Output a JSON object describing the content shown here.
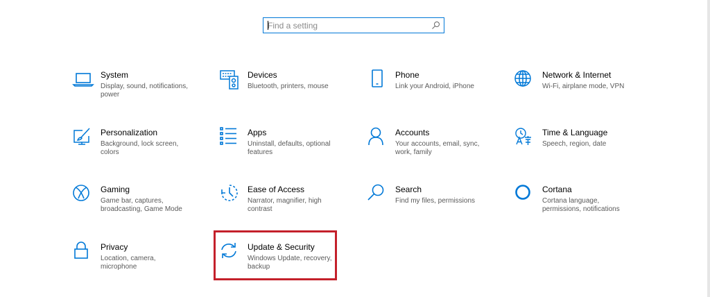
{
  "search": {
    "placeholder": "Find a setting",
    "icon": "search-icon"
  },
  "tiles": [
    {
      "title": "System",
      "desc": "Display, sound, notifications, power",
      "icon": "laptop-icon"
    },
    {
      "title": "Devices",
      "desc": "Bluetooth, printers, mouse",
      "icon": "keyboard-speaker-icon"
    },
    {
      "title": "Phone",
      "desc": "Link your Android, iPhone",
      "icon": "phone-icon"
    },
    {
      "title": "Network & Internet",
      "desc": "Wi-Fi, airplane mode, VPN",
      "icon": "globe-icon"
    },
    {
      "title": "Personalization",
      "desc": "Background, lock screen, colors",
      "icon": "paintbrush-icon"
    },
    {
      "title": "Apps",
      "desc": "Uninstall, defaults, optional features",
      "icon": "apps-list-icon"
    },
    {
      "title": "Accounts",
      "desc": "Your accounts, email, sync, work, family",
      "icon": "person-icon"
    },
    {
      "title": "Time & Language",
      "desc": "Speech, region, date",
      "icon": "language-icon"
    },
    {
      "title": "Gaming",
      "desc": "Game bar, captures, broadcasting, Game Mode",
      "icon": "xbox-icon"
    },
    {
      "title": "Ease of Access",
      "desc": "Narrator, magnifier, high contrast",
      "icon": "ease-of-access-icon"
    },
    {
      "title": "Search",
      "desc": "Find my files, permissions",
      "icon": "magnifier-icon"
    },
    {
      "title": "Cortana",
      "desc": "Cortana language, permissions, notifications",
      "icon": "cortana-ring-icon"
    },
    {
      "title": "Privacy",
      "desc": "Location, camera, microphone",
      "icon": "lock-icon"
    },
    {
      "title": "Update & Security",
      "desc": "Windows Update, recovery, backup",
      "icon": "sync-arrows-icon"
    }
  ],
  "colors": {
    "accent": "#0078d7",
    "highlight": "#c4202b",
    "title": "#000000",
    "desc": "#5a5a5a"
  }
}
